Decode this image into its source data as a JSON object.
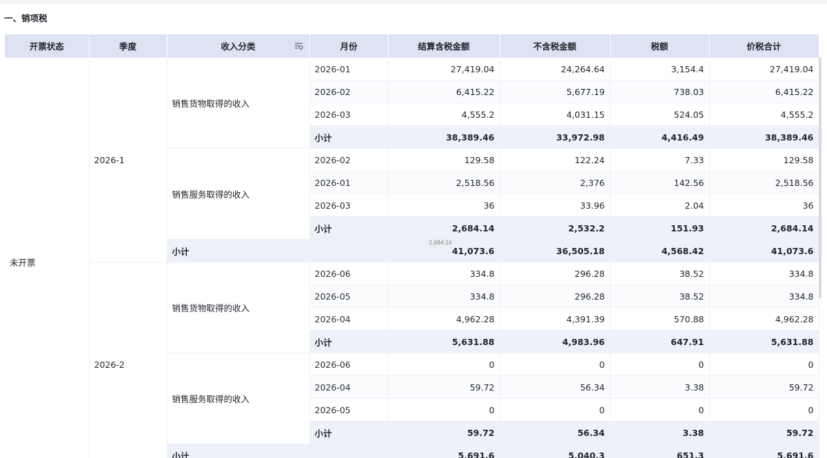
{
  "section_title": "一、销项税",
  "columns": [
    "开票状态",
    "季度",
    "收入分类",
    "月份",
    "结算含税金额",
    "不含税金额",
    "税额",
    "价税合计"
  ],
  "status": "未开票",
  "subtotal_label": "小计",
  "tooltip": "2,684.14",
  "quarters": [
    {
      "quarter": "2026-1",
      "categories": [
        {
          "name": "销售货物取得的收入",
          "rows": [
            {
              "month": "2026-01",
              "v": [
                "27,419.04",
                "24,264.64",
                "3,154.4",
                "27,419.04"
              ]
            },
            {
              "month": "2026-02",
              "v": [
                "6,415.22",
                "5,677.19",
                "738.03",
                "6,415.22"
              ]
            },
            {
              "month": "2026-03",
              "v": [
                "4,555.2",
                "4,031.15",
                "524.05",
                "4,555.2"
              ]
            }
          ],
          "subtotal": [
            "38,389.46",
            "33,972.98",
            "4,416.49",
            "38,389.46"
          ]
        },
        {
          "name": "销售服务取得的收入",
          "rows": [
            {
              "month": "2026-02",
              "v": [
                "129.58",
                "122.24",
                "7.33",
                "129.58"
              ]
            },
            {
              "month": "2026-01",
              "v": [
                "2,518.56",
                "2,376",
                "142.56",
                "2,518.56"
              ]
            },
            {
              "month": "2026-03",
              "v": [
                "36",
                "33.96",
                "2.04",
                "36"
              ]
            }
          ],
          "subtotal": [
            "2,684.14",
            "2,532.2",
            "151.93",
            "2,684.14"
          ]
        }
      ],
      "subtotal": [
        "41,073.6",
        "36,505.18",
        "4,568.42",
        "41,073.6"
      ]
    },
    {
      "quarter": "2026-2",
      "categories": [
        {
          "name": "销售货物取得的收入",
          "rows": [
            {
              "month": "2026-06",
              "v": [
                "334.8",
                "296.28",
                "38.52",
                "334.8"
              ]
            },
            {
              "month": "2026-05",
              "v": [
                "334.8",
                "296.28",
                "38.52",
                "334.8"
              ]
            },
            {
              "month": "2026-04",
              "v": [
                "4,962.28",
                "4,391.39",
                "570.88",
                "4,962.28"
              ]
            }
          ],
          "subtotal": [
            "5,631.88",
            "4,983.96",
            "647.91",
            "5,631.88"
          ]
        },
        {
          "name": "销售服务取得的收入",
          "rows": [
            {
              "month": "2026-06",
              "v": [
                "0",
                "0",
                "0",
                "0"
              ]
            },
            {
              "month": "2026-04",
              "v": [
                "59.72",
                "56.34",
                "3.38",
                "59.72"
              ]
            },
            {
              "month": "2026-05",
              "v": [
                "0",
                "0",
                "0",
                "0"
              ]
            }
          ],
          "subtotal": [
            "59.72",
            "56.34",
            "3.38",
            "59.72"
          ]
        }
      ],
      "subtotal": [
        "5,691.6",
        "5,040.3",
        "651.3",
        "5,691.6"
      ]
    }
  ]
}
